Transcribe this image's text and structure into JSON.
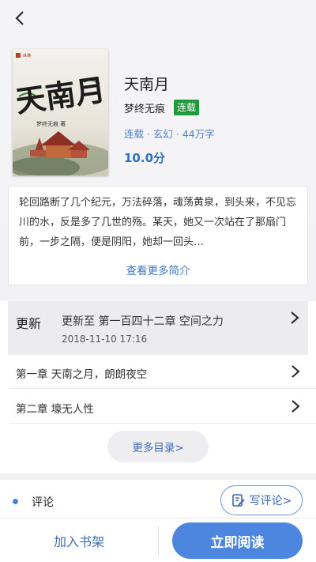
{
  "book": {
    "title": "天南月",
    "author": "梦终无痕",
    "status_badge": "连载",
    "meta": "连载 · 玄幻 · 44万字",
    "score": "10.0分",
    "cover": {
      "calligraphy": "天南月",
      "author_line": "梦终无痕 著",
      "publisher_mark": "纵横"
    }
  },
  "intro": {
    "text": "轮回路断了几个纪元，万法碎落，魂荡黄泉，到头来，不见忘川的水，反是多了几世的殇。某天，她又一次站在了那扇门前，一步之隔，便是阴阳，她却一回头…",
    "more_label": "查看更多简介"
  },
  "toc": {
    "update_label": "更新",
    "update_chapter": "更新至 第一百四十二章 空间之力",
    "update_time": "2018-11-10 17:16",
    "chapters": [
      {
        "label": "第一章 天南之月，朗朗夜空"
      },
      {
        "label": "第二章 壕无人性"
      }
    ],
    "more_label": "更多目录>"
  },
  "comments": {
    "label": "评论",
    "write_label": "写评论>"
  },
  "bottom": {
    "shelf_label": "加入书架",
    "read_label": "立即阅读"
  },
  "colors": {
    "accent": "#4d86de",
    "badge_green": "#1f9a3a",
    "link_blue": "#3d78c4"
  },
  "icons": {
    "back": "back-arrow-icon",
    "chevron": "chevron-right-icon",
    "write": "write-comment-icon"
  }
}
